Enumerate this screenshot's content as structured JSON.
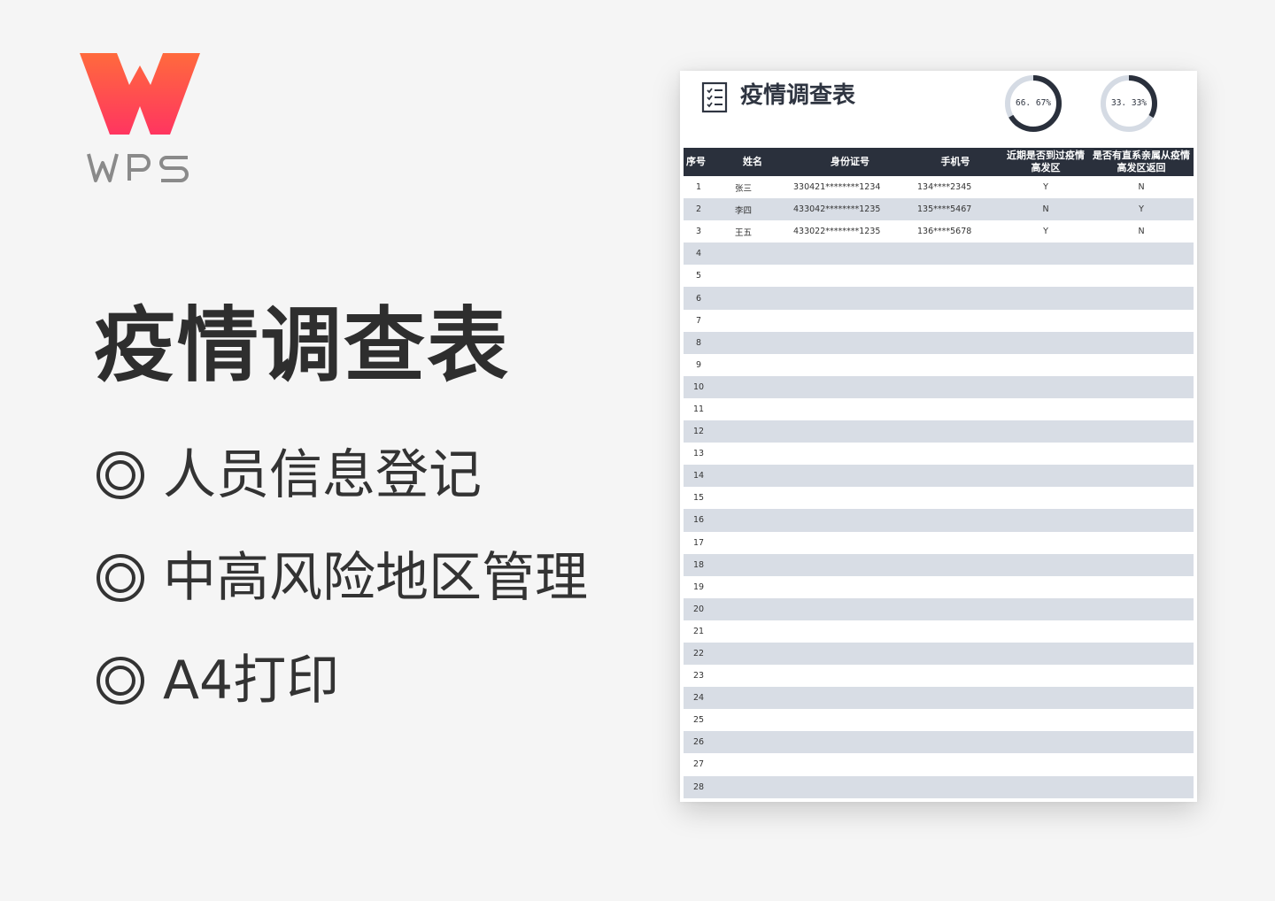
{
  "promo": {
    "logo_text": "WPS",
    "title": "疫情调查表",
    "features": [
      {
        "label": "人员信息登记"
      },
      {
        "label": "中高风险地区管理"
      },
      {
        "label": "A4打印"
      }
    ]
  },
  "sheet": {
    "title": "疫情调查表",
    "donuts": [
      {
        "label": "66. 67%",
        "value": 0.6667
      },
      {
        "label": "33. 33%",
        "value": 0.3333
      }
    ],
    "columns": [
      "序号",
      "姓名",
      "身份证号",
      "手机号",
      "近期是否到过疫情高发区",
      "是否有直系亲属从疫情高发区返回"
    ],
    "rows": [
      {
        "no": "1",
        "name": "张三",
        "id": "330421********1234",
        "phone": "134****2345",
        "visited": "Y",
        "relative": "N"
      },
      {
        "no": "2",
        "name": "李四",
        "id": "433042********1235",
        "phone": "135****5467",
        "visited": "N",
        "relative": "Y"
      },
      {
        "no": "3",
        "name": "王五",
        "id": "433022********1235",
        "phone": "136****5678",
        "visited": "Y",
        "relative": "N"
      },
      {
        "no": "4"
      },
      {
        "no": "5"
      },
      {
        "no": "6"
      },
      {
        "no": "7"
      },
      {
        "no": "8"
      },
      {
        "no": "9"
      },
      {
        "no": "10"
      },
      {
        "no": "11"
      },
      {
        "no": "12"
      },
      {
        "no": "13"
      },
      {
        "no": "14"
      },
      {
        "no": "15"
      },
      {
        "no": "16"
      },
      {
        "no": "17"
      },
      {
        "no": "18"
      },
      {
        "no": "19"
      },
      {
        "no": "20"
      },
      {
        "no": "21"
      },
      {
        "no": "22"
      },
      {
        "no": "23"
      },
      {
        "no": "24"
      },
      {
        "no": "25"
      },
      {
        "no": "26"
      },
      {
        "no": "27"
      },
      {
        "no": "28"
      }
    ]
  },
  "colors": {
    "logo_gradient_top": "#ff5a45",
    "logo_gradient_bottom": "#ff3b5c",
    "header_bg": "#2a303c",
    "row_stripe": "#d8dde5",
    "donut_fill": "#2a303c",
    "donut_track": "#d5dbe4"
  }
}
